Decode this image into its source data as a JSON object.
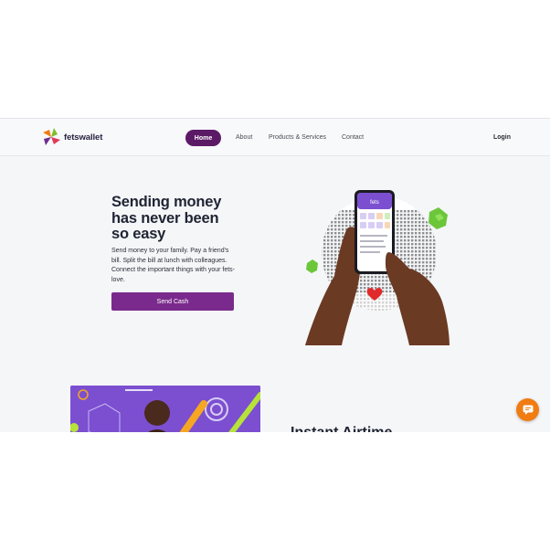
{
  "brand": {
    "name": "fetswallet"
  },
  "nav": {
    "home": "Home",
    "about": "About",
    "products": "Products & Services",
    "contact": "Contact",
    "login": "Login"
  },
  "hero": {
    "title": "Sending money has never been so easy",
    "description": "Send money to your family. Pay a friend's bill. Split the bill at lunch with colleagues. Connect the important things with your fets-love.",
    "cta": "Send Cash",
    "phone_app_name": "fets"
  },
  "next_section": {
    "heading": "Instant Airtime"
  },
  "colors": {
    "primary": "#5b1a66",
    "button": "#7a2a8c",
    "promo_bg": "#7b4fd0",
    "chat": "#f07c12"
  },
  "icons": {
    "chat": "chat-bubble-icon"
  }
}
